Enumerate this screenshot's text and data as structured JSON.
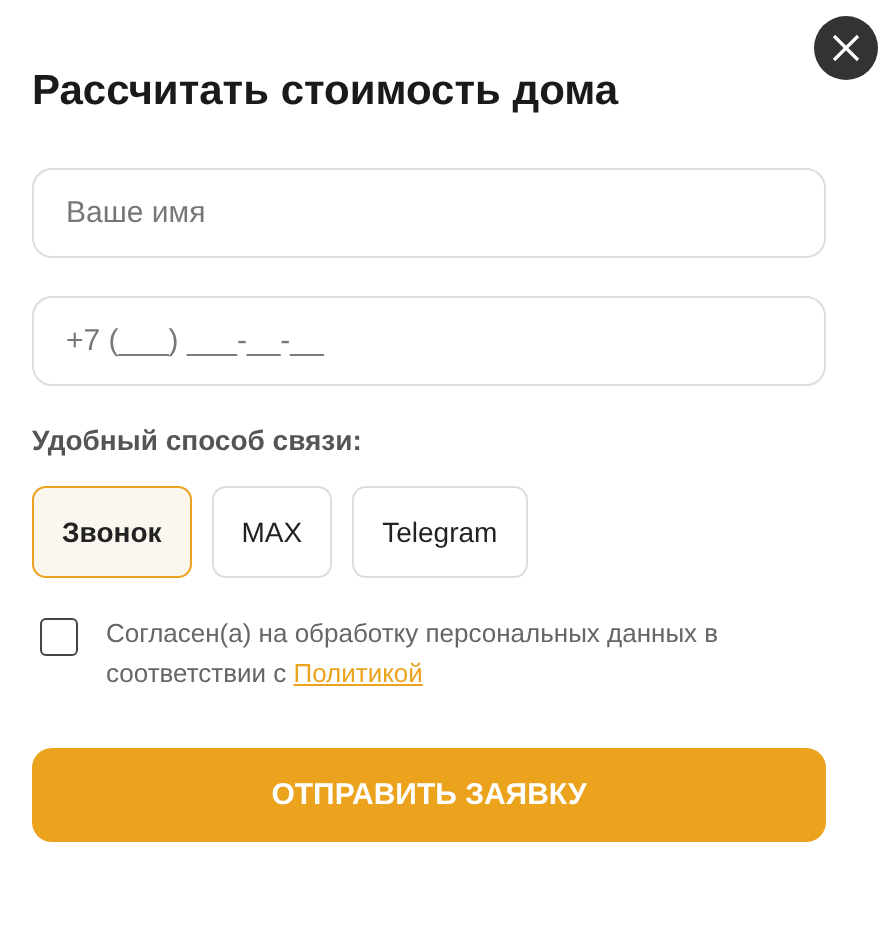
{
  "title": "Рассчитать стоимость дома",
  "fields": [
    {
      "placeholder": "Ваше имя"
    },
    {
      "placeholder": "+7 (___) ___-__-__"
    }
  ],
  "contact_label": "Удобный способ связи:",
  "contact_options": [
    {
      "label": "Звонок",
      "selected": true
    },
    {
      "label": "MAX",
      "selected": false
    },
    {
      "label": "Telegram",
      "selected": false
    }
  ],
  "consent": {
    "checked": false,
    "text": "Согласен(а) на обработку персональных данных в соответствии с ",
    "link": "Политикой"
  },
  "submit": "ОТПРАВИТЬ ЗАЯВКУ"
}
